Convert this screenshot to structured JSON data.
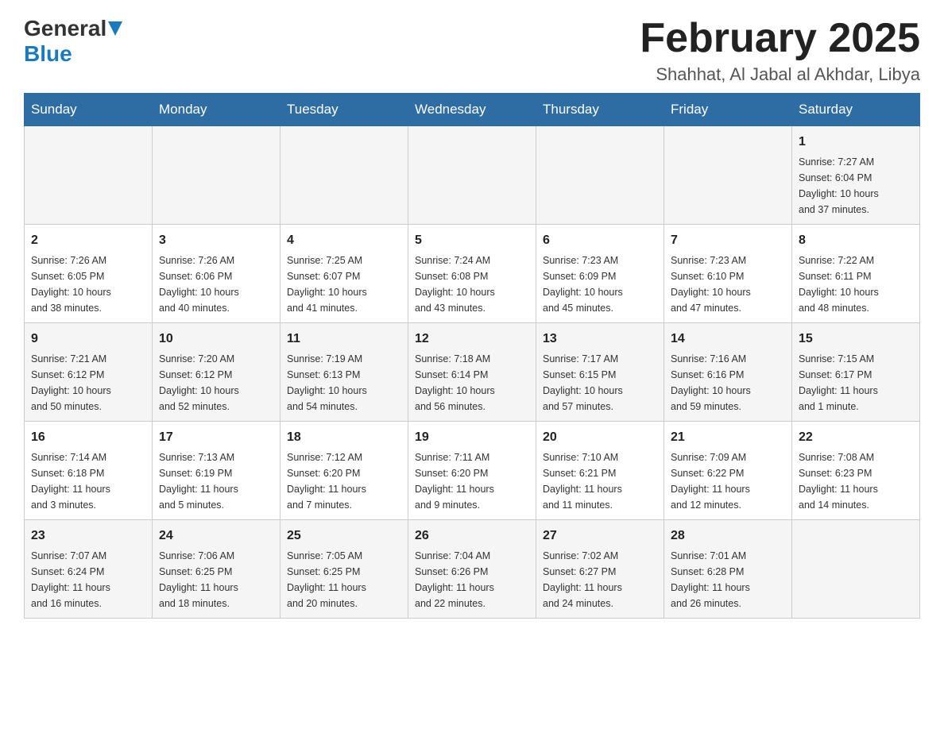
{
  "header": {
    "logo": {
      "general": "General",
      "blue": "Blue",
      "triangle": "▲"
    },
    "title": "February 2025",
    "location": "Shahhat, Al Jabal al Akhdar, Libya"
  },
  "calendar": {
    "days_of_week": [
      "Sunday",
      "Monday",
      "Tuesday",
      "Wednesday",
      "Thursday",
      "Friday",
      "Saturday"
    ],
    "weeks": [
      {
        "days": [
          {
            "number": "",
            "info": ""
          },
          {
            "number": "",
            "info": ""
          },
          {
            "number": "",
            "info": ""
          },
          {
            "number": "",
            "info": ""
          },
          {
            "number": "",
            "info": ""
          },
          {
            "number": "",
            "info": ""
          },
          {
            "number": "1",
            "info": "Sunrise: 7:27 AM\nSunset: 6:04 PM\nDaylight: 10 hours\nand 37 minutes."
          }
        ]
      },
      {
        "days": [
          {
            "number": "2",
            "info": "Sunrise: 7:26 AM\nSunset: 6:05 PM\nDaylight: 10 hours\nand 38 minutes."
          },
          {
            "number": "3",
            "info": "Sunrise: 7:26 AM\nSunset: 6:06 PM\nDaylight: 10 hours\nand 40 minutes."
          },
          {
            "number": "4",
            "info": "Sunrise: 7:25 AM\nSunset: 6:07 PM\nDaylight: 10 hours\nand 41 minutes."
          },
          {
            "number": "5",
            "info": "Sunrise: 7:24 AM\nSunset: 6:08 PM\nDaylight: 10 hours\nand 43 minutes."
          },
          {
            "number": "6",
            "info": "Sunrise: 7:23 AM\nSunset: 6:09 PM\nDaylight: 10 hours\nand 45 minutes."
          },
          {
            "number": "7",
            "info": "Sunrise: 7:23 AM\nSunset: 6:10 PM\nDaylight: 10 hours\nand 47 minutes."
          },
          {
            "number": "8",
            "info": "Sunrise: 7:22 AM\nSunset: 6:11 PM\nDaylight: 10 hours\nand 48 minutes."
          }
        ]
      },
      {
        "days": [
          {
            "number": "9",
            "info": "Sunrise: 7:21 AM\nSunset: 6:12 PM\nDaylight: 10 hours\nand 50 minutes."
          },
          {
            "number": "10",
            "info": "Sunrise: 7:20 AM\nSunset: 6:12 PM\nDaylight: 10 hours\nand 52 minutes."
          },
          {
            "number": "11",
            "info": "Sunrise: 7:19 AM\nSunset: 6:13 PM\nDaylight: 10 hours\nand 54 minutes."
          },
          {
            "number": "12",
            "info": "Sunrise: 7:18 AM\nSunset: 6:14 PM\nDaylight: 10 hours\nand 56 minutes."
          },
          {
            "number": "13",
            "info": "Sunrise: 7:17 AM\nSunset: 6:15 PM\nDaylight: 10 hours\nand 57 minutes."
          },
          {
            "number": "14",
            "info": "Sunrise: 7:16 AM\nSunset: 6:16 PM\nDaylight: 10 hours\nand 59 minutes."
          },
          {
            "number": "15",
            "info": "Sunrise: 7:15 AM\nSunset: 6:17 PM\nDaylight: 11 hours\nand 1 minute."
          }
        ]
      },
      {
        "days": [
          {
            "number": "16",
            "info": "Sunrise: 7:14 AM\nSunset: 6:18 PM\nDaylight: 11 hours\nand 3 minutes."
          },
          {
            "number": "17",
            "info": "Sunrise: 7:13 AM\nSunset: 6:19 PM\nDaylight: 11 hours\nand 5 minutes."
          },
          {
            "number": "18",
            "info": "Sunrise: 7:12 AM\nSunset: 6:20 PM\nDaylight: 11 hours\nand 7 minutes."
          },
          {
            "number": "19",
            "info": "Sunrise: 7:11 AM\nSunset: 6:20 PM\nDaylight: 11 hours\nand 9 minutes."
          },
          {
            "number": "20",
            "info": "Sunrise: 7:10 AM\nSunset: 6:21 PM\nDaylight: 11 hours\nand 11 minutes."
          },
          {
            "number": "21",
            "info": "Sunrise: 7:09 AM\nSunset: 6:22 PM\nDaylight: 11 hours\nand 12 minutes."
          },
          {
            "number": "22",
            "info": "Sunrise: 7:08 AM\nSunset: 6:23 PM\nDaylight: 11 hours\nand 14 minutes."
          }
        ]
      },
      {
        "days": [
          {
            "number": "23",
            "info": "Sunrise: 7:07 AM\nSunset: 6:24 PM\nDaylight: 11 hours\nand 16 minutes."
          },
          {
            "number": "24",
            "info": "Sunrise: 7:06 AM\nSunset: 6:25 PM\nDaylight: 11 hours\nand 18 minutes."
          },
          {
            "number": "25",
            "info": "Sunrise: 7:05 AM\nSunset: 6:25 PM\nDaylight: 11 hours\nand 20 minutes."
          },
          {
            "number": "26",
            "info": "Sunrise: 7:04 AM\nSunset: 6:26 PM\nDaylight: 11 hours\nand 22 minutes."
          },
          {
            "number": "27",
            "info": "Sunrise: 7:02 AM\nSunset: 6:27 PM\nDaylight: 11 hours\nand 24 minutes."
          },
          {
            "number": "28",
            "info": "Sunrise: 7:01 AM\nSunset: 6:28 PM\nDaylight: 11 hours\nand 26 minutes."
          },
          {
            "number": "",
            "info": ""
          }
        ]
      }
    ]
  }
}
